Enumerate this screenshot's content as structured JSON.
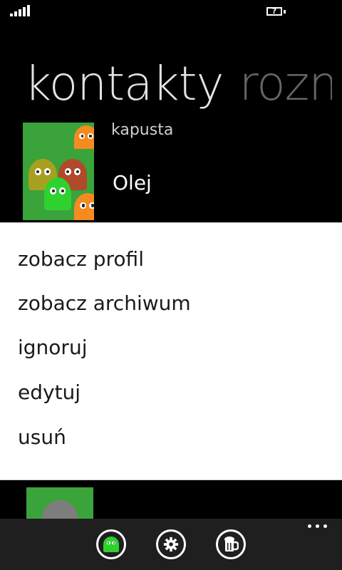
{
  "status": {
    "battery_label": "?"
  },
  "pivot": {
    "active": "kontakty",
    "next": "rozmowy"
  },
  "contacts": {
    "previous_name": "kapusta",
    "selected_name": "Olej"
  },
  "context_menu": {
    "items": [
      {
        "label": "zobacz profil"
      },
      {
        "label": "zobacz archiwum"
      },
      {
        "label": "ignoruj"
      },
      {
        "label": "edytuj"
      },
      {
        "label": "usuń"
      }
    ]
  },
  "app_bar": {
    "buttons": [
      "ghost-icon",
      "gear-icon",
      "beer-mug-icon"
    ],
    "more_icon": "ellipsis-icon"
  },
  "colors": {
    "accent_green": "#3aa33a",
    "orange": "#f58a1f",
    "menu_bg": "#ffffff",
    "app_bar_bg": "#1f1f1f"
  }
}
